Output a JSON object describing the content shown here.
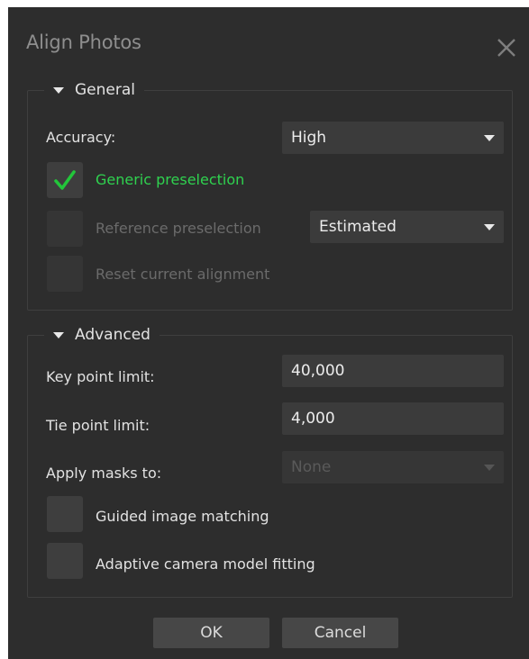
{
  "dialog": {
    "title": "Align Photos"
  },
  "general": {
    "header": "General",
    "accuracy": {
      "label": "Accuracy:",
      "value": "High"
    },
    "generic_preselection": {
      "label": "Generic preselection",
      "checked": true
    },
    "reference_preselection": {
      "label": "Reference preselection",
      "checked": false,
      "enabled": false,
      "mode": "Estimated"
    },
    "reset_alignment": {
      "label": "Reset current alignment",
      "checked": false,
      "enabled": false
    }
  },
  "advanced": {
    "header": "Advanced",
    "key_point_limit": {
      "label": "Key point limit:",
      "value": "40,000"
    },
    "tie_point_limit": {
      "label": "Tie point limit:",
      "value": "4,000"
    },
    "apply_masks": {
      "label": "Apply masks to:",
      "value": "None",
      "enabled": false
    },
    "guided_matching": {
      "label": "Guided image matching",
      "checked": false
    },
    "adaptive_fitting": {
      "label": "Adaptive camera model fitting",
      "checked": false
    }
  },
  "buttons": {
    "ok": "OK",
    "cancel": "Cancel"
  },
  "colors": {
    "background": "#2d2d2d",
    "checked_text": "#2fd24f",
    "checkmark": "#22c63a"
  },
  "icons": {
    "close": "close-icon",
    "checkmark": "checkmark-icon",
    "expand": "triangle-down-icon"
  }
}
